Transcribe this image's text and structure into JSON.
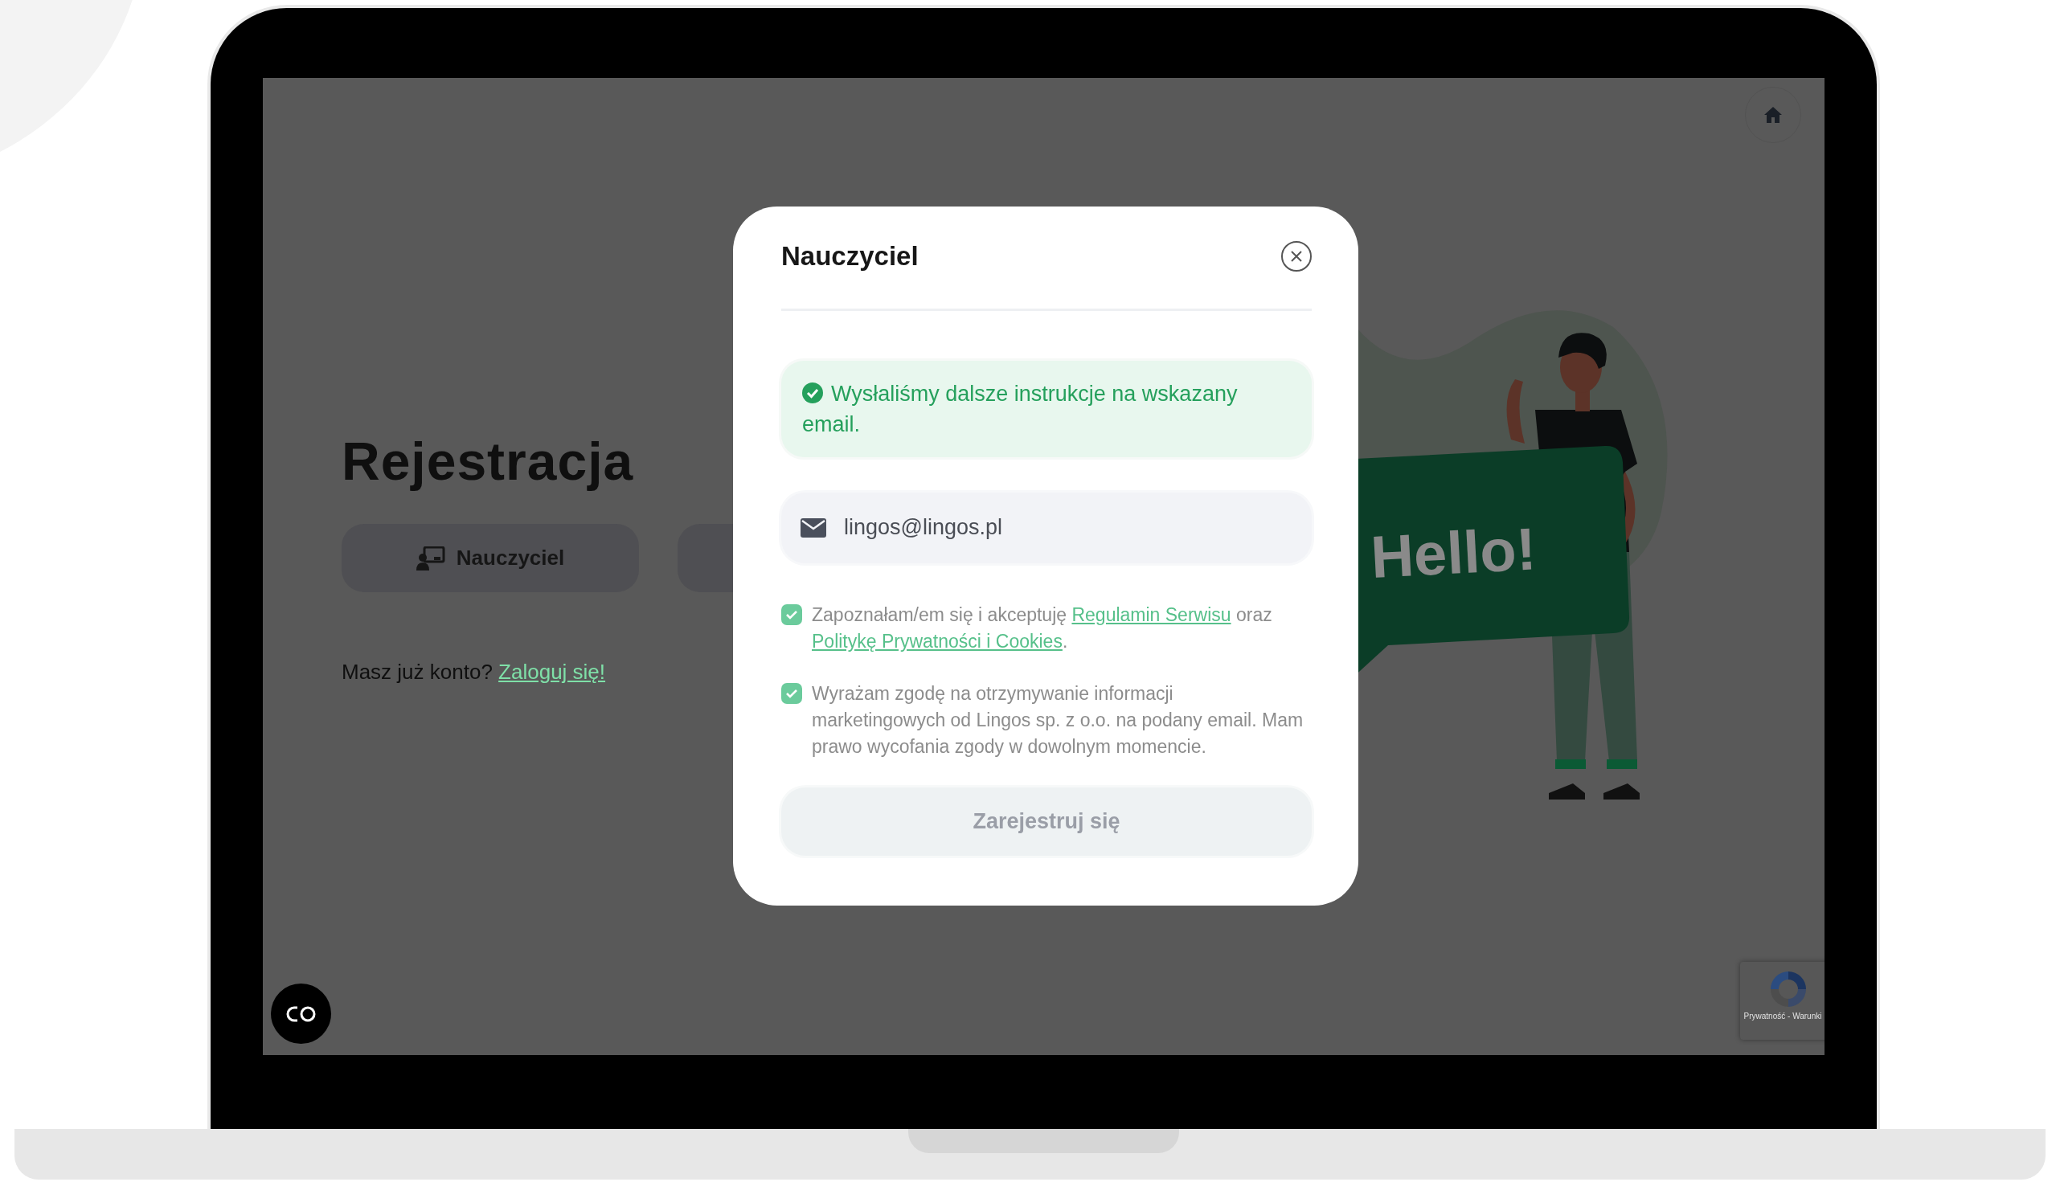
{
  "page": {
    "heading": "Rejestracja",
    "role_buttons": [
      {
        "kind": "teacher",
        "label": "Nauczyciel"
      },
      {
        "kind": "student"
      }
    ],
    "login_prompt": {
      "text": "Masz już konto?",
      "link": "Zaloguj się!"
    }
  },
  "illustration": {
    "bubble_text": "Hello!"
  },
  "recaptcha": {
    "text": "Prywatność - Warunki"
  },
  "modal": {
    "title": "Nauczyciel",
    "alert": {
      "kind": "success",
      "text": "Wysłaliśmy dalsze instrukcje na wskazany email."
    },
    "email": {
      "value": "lingos@lingos.pl"
    },
    "consents": [
      {
        "checked": true,
        "segments": [
          {
            "kind": "text",
            "text": "Zapoznałam/em się i akceptuję "
          },
          {
            "kind": "link",
            "text": "Regulamin Serwisu"
          },
          {
            "kind": "text",
            "text": " oraz "
          },
          {
            "kind": "link",
            "text": "Politykę Prywatności i Cookies"
          },
          {
            "kind": "text",
            "text": "."
          }
        ]
      },
      {
        "checked": true,
        "segments": [
          {
            "kind": "text",
            "text": "Wyrażam zgodę na otrzymywanie informacji marketingowych od Lingos sp. z o.o. na podany email. Mam prawo wycofania zgody w dowolnym momencie."
          }
        ]
      }
    ],
    "submit": {
      "label": "Zarejestruj się",
      "disabled": true
    }
  }
}
